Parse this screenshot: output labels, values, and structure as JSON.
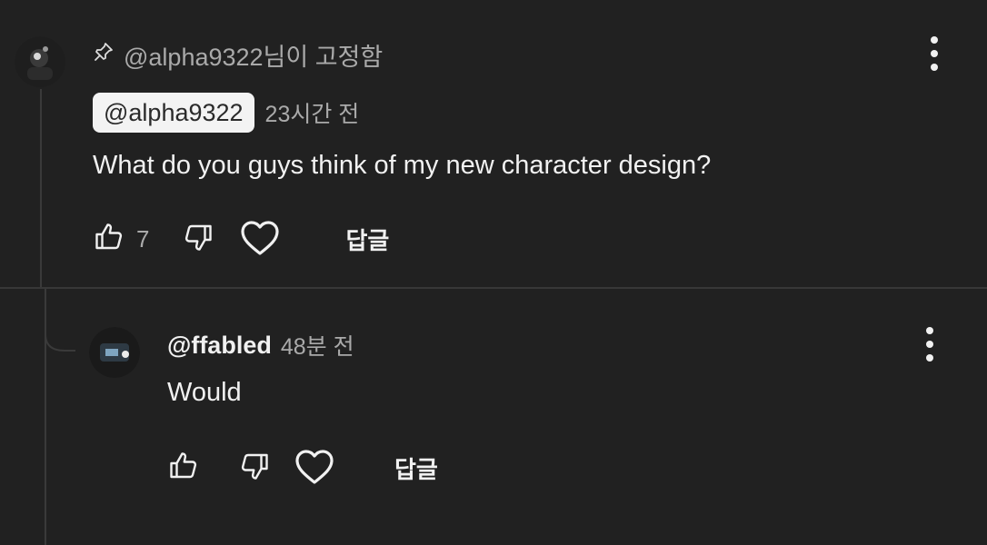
{
  "pinned": {
    "pin_icon": "pin-icon",
    "label": "@alpha9322님이 고정함"
  },
  "comment": {
    "author": "@alpha9322",
    "time": "23시간 전",
    "text": "What do you guys think of my new character design?",
    "like_count": "7",
    "reply_label": "답글",
    "icons": [
      "thumbs-up-icon",
      "thumbs-down-icon",
      "heart-icon",
      "more-vert-icon"
    ]
  },
  "reply": {
    "author": "@ffabled",
    "time": "48분 전",
    "text": "Would",
    "reply_label": "답글",
    "icons": [
      "thumbs-up-icon",
      "thumbs-down-icon",
      "heart-icon",
      "more-vert-icon"
    ]
  },
  "colors": {
    "background": "#212121",
    "text": "#f1f1f1",
    "secondary_text": "#aaaaaa",
    "chip_bg": "#f3f3f3"
  }
}
